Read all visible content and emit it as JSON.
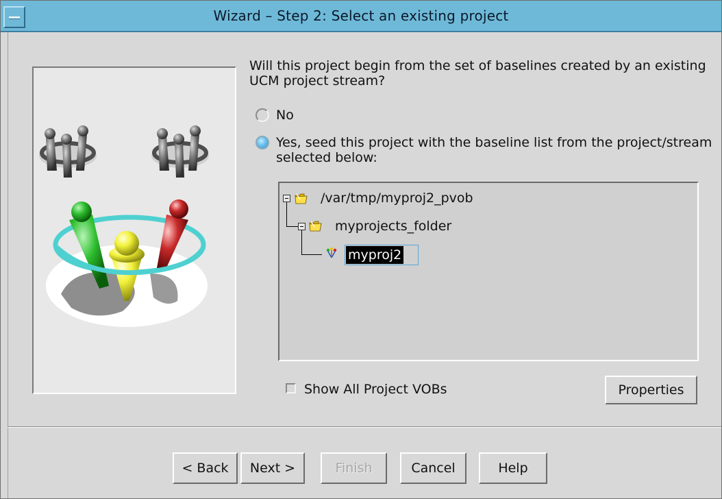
{
  "window": {
    "title": "Wizard – Step 2:  Select an existing project"
  },
  "question": {
    "text": "Will this project begin from the set of baselines created by an existing UCM project stream?"
  },
  "options": {
    "no_label": "No",
    "no_selected": false,
    "yes_label": "Yes, seed this project with the baseline list from the project/stream selected below:",
    "yes_selected": true
  },
  "tree": {
    "root": {
      "label": "/var/tmp/myproj2_pvob",
      "icon": "folder-icon",
      "expanded": true
    },
    "folder": {
      "label": "myprojects_folder",
      "icon": "folder-icon",
      "expanded": true
    },
    "project": {
      "label": "myproj2",
      "icon": "ucm-project-icon",
      "selected": true
    }
  },
  "show_all_vobs": {
    "label": "Show All Project VOBs",
    "checked": false
  },
  "buttons": {
    "properties": "Properties",
    "back": "< Back",
    "next": "Next >",
    "finish": "Finish",
    "finish_enabled": false,
    "cancel": "Cancel",
    "help": "Help"
  },
  "colors": {
    "titlebar": "#6fb9d8",
    "window_bg": "#d8d8d8",
    "selection_bg": "#000000",
    "radio_on": "#6cc0ee"
  }
}
